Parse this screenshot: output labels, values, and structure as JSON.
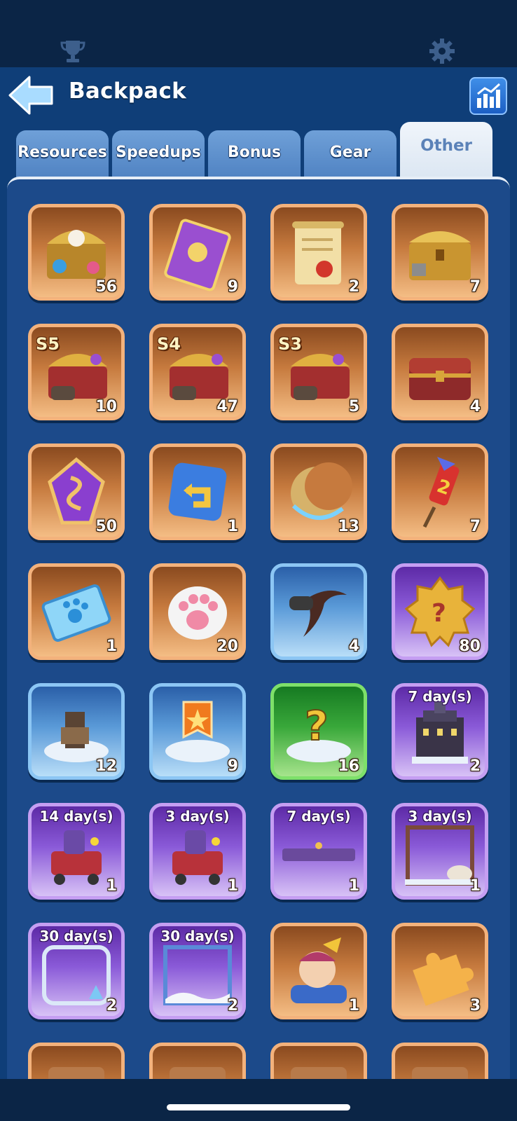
{
  "topbar": {
    "left_icon": "trophy-icon",
    "right_icon": "gear-icon"
  },
  "header": {
    "title": "Backpack",
    "back_icon": "back-arrow-icon",
    "stats_icon": "stats-chart-icon"
  },
  "tabs": [
    {
      "label": "Resources",
      "active": false
    },
    {
      "label": "Speedups",
      "active": false
    },
    {
      "label": "Bonus",
      "active": false
    },
    {
      "label": "Gear",
      "active": false
    },
    {
      "label": "Other",
      "active": true
    }
  ],
  "items": [
    {
      "icon": "pet-chest-icon",
      "count": "56",
      "frame": "orange"
    },
    {
      "icon": "purple-card-icon",
      "count": "9",
      "frame": "orange"
    },
    {
      "icon": "scroll-icon",
      "count": "2",
      "frame": "orange"
    },
    {
      "icon": "gold-chest-icon",
      "count": "7",
      "frame": "orange"
    },
    {
      "icon": "season-chest-icon",
      "season": "S5",
      "count": "10",
      "frame": "orange"
    },
    {
      "icon": "season-chest-icon",
      "season": "S4",
      "count": "47",
      "frame": "orange"
    },
    {
      "icon": "season-chest-icon",
      "season": "S3",
      "count": "5",
      "frame": "orange"
    },
    {
      "icon": "red-chest-icon",
      "count": "4",
      "frame": "orange"
    },
    {
      "icon": "purple-rune-icon",
      "count": "50",
      "frame": "orange"
    },
    {
      "icon": "return-tile-icon",
      "count": "1",
      "frame": "orange"
    },
    {
      "icon": "crescent-moon-icon",
      "count": "13",
      "frame": "orange"
    },
    {
      "icon": "firework-rocket-icon",
      "count": "7",
      "frame": "orange"
    },
    {
      "icon": "paw-ticket-icon",
      "count": "1",
      "frame": "orange"
    },
    {
      "icon": "paw-cushion-icon",
      "count": "20",
      "frame": "orange"
    },
    {
      "icon": "dark-scythe-icon",
      "count": "4",
      "frame": "blue"
    },
    {
      "icon": "mystery-badge-icon",
      "count": "80",
      "frame": "purple"
    },
    {
      "icon": "building-platform-icon",
      "count": "12",
      "frame": "blue"
    },
    {
      "icon": "banner-platform-icon",
      "count": "9",
      "frame": "blue"
    },
    {
      "icon": "mystery-platform-icon",
      "count": "16",
      "frame": "green"
    },
    {
      "icon": "castle-skin-icon",
      "days": "7 day(s)",
      "count": "2",
      "frame": "purple"
    },
    {
      "icon": "vehicle-skin-icon",
      "days": "14 day(s)",
      "count": "1",
      "frame": "purple"
    },
    {
      "icon": "vehicle-skin-icon",
      "days": "3 day(s)",
      "count": "1",
      "frame": "purple"
    },
    {
      "icon": "nameplate-icon",
      "days": "7 day(s)",
      "count": "1",
      "frame": "purple"
    },
    {
      "icon": "skull-frame-icon",
      "days": "3 day(s)",
      "count": "1",
      "frame": "purple"
    },
    {
      "icon": "ice-frame-icon",
      "days": "30 day(s)",
      "count": "2",
      "frame": "purple"
    },
    {
      "icon": "snow-frame-icon",
      "days": "30 day(s)",
      "count": "2",
      "frame": "purple"
    },
    {
      "icon": "avatar-character-icon",
      "count": "1",
      "frame": "orange"
    },
    {
      "icon": "puzzle-piece-icon",
      "count": "3",
      "frame": "orange"
    },
    {
      "icon": "partial-item-icon",
      "count": "",
      "frame": "orange"
    },
    {
      "icon": "partial-item-icon",
      "count": "",
      "frame": "orange"
    },
    {
      "icon": "partial-item-icon",
      "count": "",
      "frame": "orange"
    },
    {
      "icon": "partial-item-icon",
      "count": "",
      "frame": "orange"
    }
  ]
}
